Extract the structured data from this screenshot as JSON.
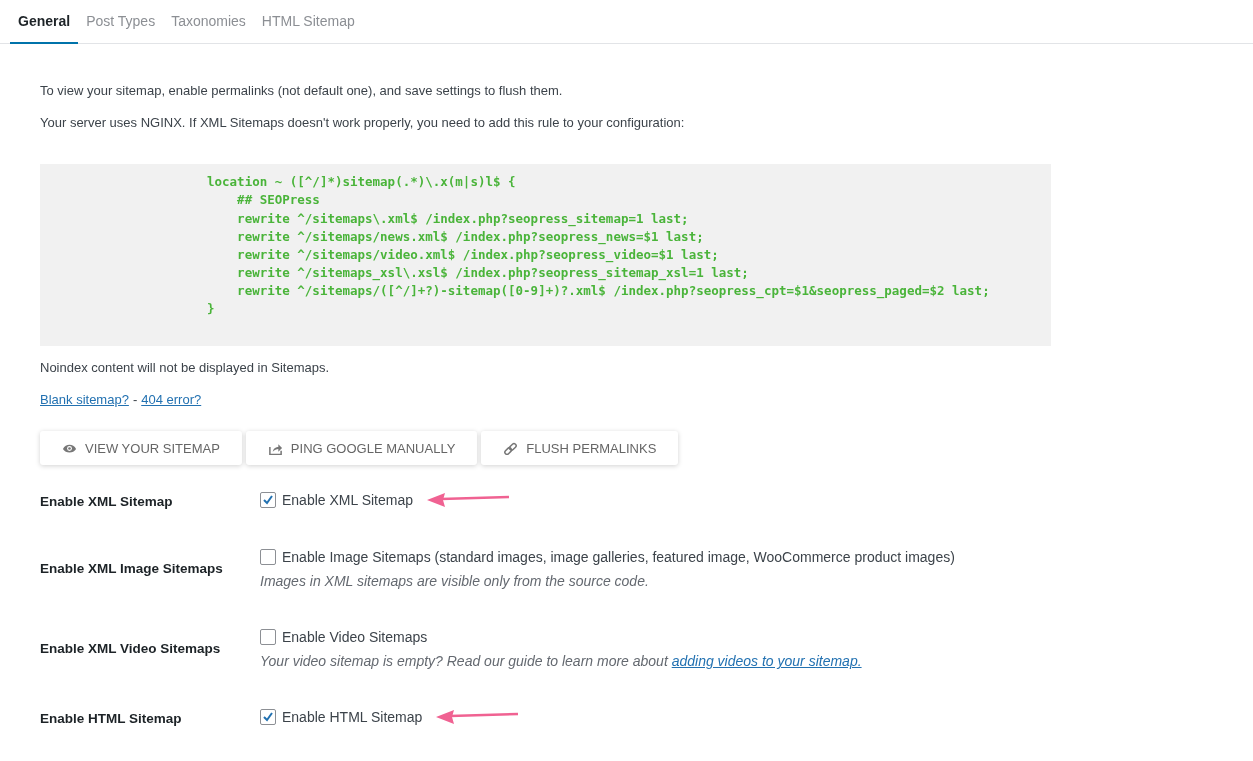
{
  "tabs": [
    {
      "label": "General",
      "selected": true
    },
    {
      "label": "Post Types",
      "selected": false
    },
    {
      "label": "Taxonomies",
      "selected": false
    },
    {
      "label": "HTML Sitemap",
      "selected": false
    }
  ],
  "intro": [
    "To view your sitemap, enable permalinks (not default one), and save settings to flush them.",
    "Your server uses NGINX. If XML Sitemaps doesn't work properly, you need to add this rule to your configuration:"
  ],
  "code_lines": [
    "location ~ ([^/]*)sitemap(.*)\\.x(m|s)l$ {",
    "    ## SEOPress",
    "    rewrite ^/sitemaps\\.xml$ /index.php?seopress_sitemap=1 last;",
    "    rewrite ^/sitemaps/news.xml$ /index.php?seopress_news=$1 last;",
    "    rewrite ^/sitemaps/video.xml$ /index.php?seopress_video=$1 last;",
    "    rewrite ^/sitemaps_xsl\\.xsl$ /index.php?seopress_sitemap_xsl=1 last;",
    "    rewrite ^/sitemaps/([^/]+?)-sitemap([0-9]+)?.xml$ /index.php?seopress_cpt=$1&seopress_paged=$2 last;",
    "}"
  ],
  "noindex_note": "Noindex content will not be displayed in Sitemaps.",
  "help_links": [
    "Blank sitemap?",
    "404 error?"
  ],
  "help_separator": "-",
  "buttons": [
    {
      "label": "VIEW YOUR SITEMAP"
    },
    {
      "label": "PING GOOGLE MANUALLY"
    },
    {
      "label": "FLUSH PERMALINKS"
    }
  ],
  "settings": [
    {
      "label": "Enable XML Sitemap",
      "option": "Enable XML Sitemap",
      "checked": true,
      "annotated": true
    },
    {
      "label": "Enable XML Image Sitemaps",
      "option": "Enable Image Sitemaps (standard images, image galleries, featured image, WooCommerce product images)",
      "checked": false,
      "annotated": false,
      "description": "Images in XML sitemaps are visible only from the source code."
    },
    {
      "label": "Enable XML Video Sitemaps",
      "option": "Enable Video Sitemaps",
      "checked": false,
      "annotated": false,
      "description": "Your video sitemap is empty? Read our guide to learn more about",
      "description_link": "adding videos to your sitemap."
    },
    {
      "label": "Enable HTML Sitemap",
      "option": "Enable HTML Sitemap",
      "checked": true,
      "annotated": true
    }
  ]
}
